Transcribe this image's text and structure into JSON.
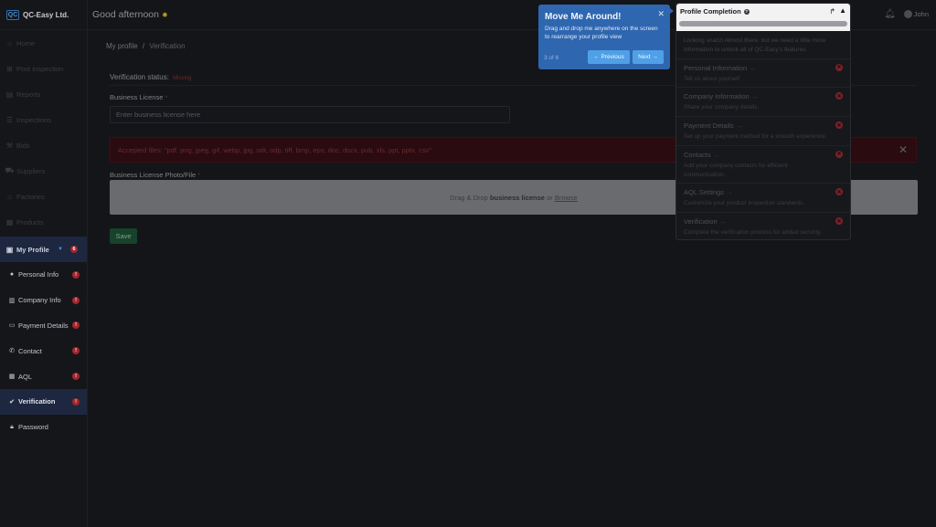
{
  "brand": {
    "name": "QC-Easy Ltd.",
    "logo_text": "QC"
  },
  "header": {
    "greeting": "Good afternoon",
    "user": "John"
  },
  "sidebar": {
    "items": [
      {
        "label": "Home"
      },
      {
        "label": "Post Inspection"
      },
      {
        "label": "Reports"
      },
      {
        "label": "Inspections"
      },
      {
        "label": "Bids"
      },
      {
        "label": "Suppliers"
      },
      {
        "label": "Factories"
      },
      {
        "label": "Products"
      }
    ],
    "my_profile": {
      "label": "My Profile",
      "badge": "6"
    },
    "sub_items": [
      {
        "label": "Personal Info",
        "badge": "!"
      },
      {
        "label": "Company Info",
        "badge": "!"
      },
      {
        "label": "Payment Details",
        "badge": "!"
      },
      {
        "label": "Contact",
        "badge": "!"
      },
      {
        "label": "AQL",
        "badge": "!"
      },
      {
        "label": "Verification",
        "badge": "!"
      },
      {
        "label": "Password"
      }
    ]
  },
  "breadcrumb": {
    "parent": "My profile",
    "separator": "/",
    "current": "Verification"
  },
  "form": {
    "status_label": "Verification status:",
    "status_value": "Missing",
    "license_label": "Business License",
    "required_mark": "*",
    "license_placeholder": "Enter business license here",
    "accepted_files": "Accepted files: \"pdf, png, jpeg, gif, webp, jpg, odt, odp, tiff, bmp, eps, doc, docx, pub, xls, ppt, pptx, csv\"",
    "photo_label": "Business License Photo/File",
    "dropzone_prefix": "Drag & Drop",
    "dropzone_bold": "business license",
    "dropzone_or": "or",
    "dropzone_browse": "Browse",
    "save_label": "Save"
  },
  "tour": {
    "title": "Move Me Around!",
    "body": "Drag and drop me anywhere on the screen to rearrange your profile view",
    "step": "3 of 6",
    "prev_label": "← Previous",
    "next_label": "Next →"
  },
  "profile_completion": {
    "title": "Profile Completion",
    "intro": "Looking snazzi Almost there, but we need a little more information to unlock all of QC-Easy's features.",
    "items": [
      {
        "title": "Personal Information",
        "desc": "Tell us about yourself"
      },
      {
        "title": "Company Information",
        "desc": "Share your company details."
      },
      {
        "title": "Payment Details",
        "desc": "Set up your payment method for a smooth experience."
      },
      {
        "title": "Contacts",
        "desc": "Add your company contacts for efficient communication."
      },
      {
        "title": "AQL Settings",
        "desc": "Customize your product inspection standards."
      },
      {
        "title": "Verification",
        "desc": "Complete the verification process for added security."
      }
    ]
  },
  "colors": {
    "accent": "#2f66b0",
    "danger": "#a4252b",
    "save": "#17422b"
  }
}
